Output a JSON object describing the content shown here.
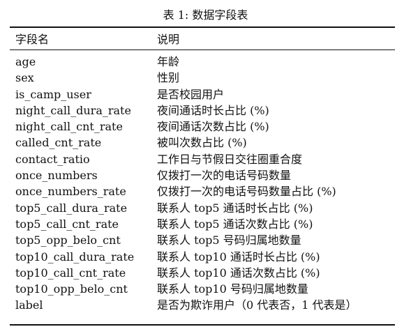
{
  "caption": "表 1: 数据字段表",
  "table": {
    "headers": [
      "字段名",
      "说明"
    ],
    "rows": [
      [
        "age",
        "年龄"
      ],
      [
        "sex",
        "性别"
      ],
      [
        "is_camp_user",
        "是否校园用户"
      ],
      [
        "night_call_dura_rate",
        "夜间通话时长占比 (%)"
      ],
      [
        "night_call_cnt_rate",
        "夜间通话次数占比 (%)"
      ],
      [
        "called_cnt_rate",
        "被叫次数占比 (%)"
      ],
      [
        "contact_ratio",
        "工作日与节假日交往圈重合度"
      ],
      [
        "once_numbers",
        "仅拨打一次的电话号码数量"
      ],
      [
        "once_numbers_rate",
        "仅拨打一次的电话号码数量占比 (%)"
      ],
      [
        "top5_call_dura_rate",
        "联系人 top5 通话时长占比 (%)"
      ],
      [
        "top5_call_cnt_rate",
        "联系人 top5 通话次数占比 (%)"
      ],
      [
        "top5_opp_belo_cnt",
        "联系人 top5 号码归属地数量"
      ],
      [
        "top10_call_dura_rate",
        "联系人 top10 通话时长占比 (%)"
      ],
      [
        "top10_call_cnt_rate",
        "联系人 top10 通话次数占比 (%)"
      ],
      [
        "top10_opp_belo_cnt",
        "联系人 top10 号码归属地数量"
      ],
      [
        "label",
        "是否为欺诈用户（0 代表否，1 代表是）"
      ]
    ]
  }
}
